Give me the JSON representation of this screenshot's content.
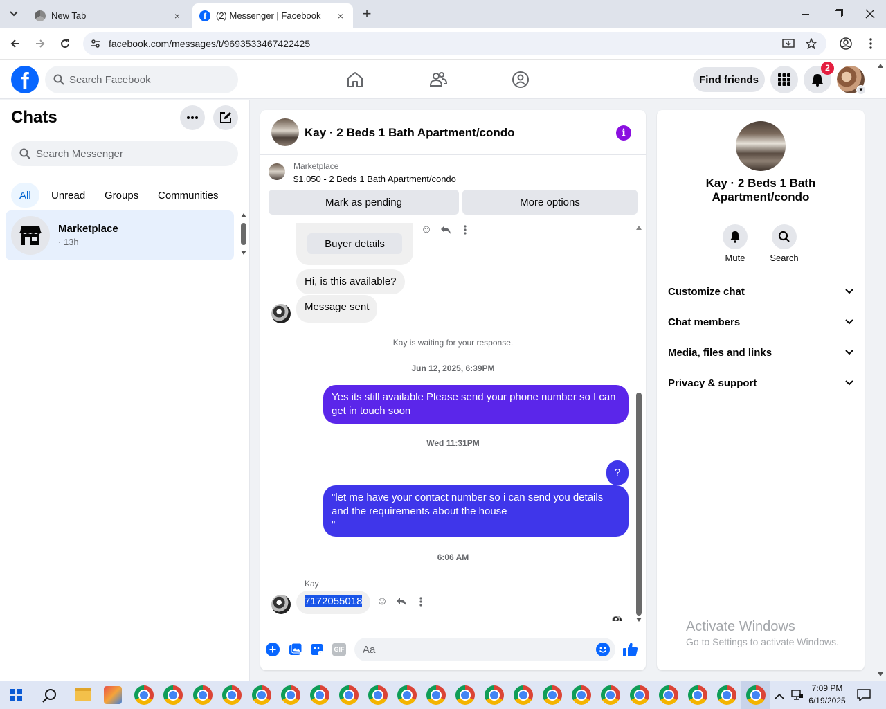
{
  "browser": {
    "tabs": [
      {
        "label": "New Tab",
        "active": false
      },
      {
        "label": "(2) Messenger | Facebook",
        "active": true
      }
    ],
    "new_tab_glyph": "+",
    "close_glyph": "×",
    "url": "facebook.com/messages/t/9693533467422425"
  },
  "fb_header": {
    "logo_letter": "f",
    "search_placeholder": "Search Facebook",
    "find_friends_label": "Find friends",
    "notification_count": "2",
    "nav_icons": [
      "home-icon",
      "friends-icon",
      "groups-icon"
    ]
  },
  "chats": {
    "title": "Chats",
    "search_placeholder": "Search Messenger",
    "filters": [
      "All",
      "Unread",
      "Groups",
      "Communities"
    ],
    "active_filter": "All",
    "items": [
      {
        "name": "Marketplace",
        "meta": "· 13h"
      }
    ]
  },
  "conversation": {
    "title": "Kay · 2 Beds 1 Bath Apartment/condo",
    "listing": {
      "source": "Marketplace",
      "summary": "$1,050 - 2 Beds 1 Bath Apartment/condo",
      "mark_pending_label": "Mark as pending",
      "more_options_label": "More options"
    },
    "messages": {
      "buyer_details_label": "Buyer details",
      "auto_question": "Hi, is this available?",
      "message_sent": "Message sent",
      "waiting_note": "Kay is waiting for your response.",
      "timestamp_1": "Jun 12, 2025, 6:39PM",
      "reply_1": "Yes its still available Please send your phone number so I can get in touch soon",
      "timestamp_2": "Wed 11:31PM",
      "reply_2": "?",
      "reply_3_line1": "\"let me have your contact number so i can send you details",
      "reply_3_line2": "and the requirements about the house",
      "reply_3_line3": "\"",
      "timestamp_3": "6:06 AM",
      "sender_name": "Kay",
      "phone_message": "7172055018"
    },
    "composer_placeholder": "Aa",
    "composer_icons": [
      "plus-icon",
      "photo-icon",
      "sticker-icon",
      "gif-icon",
      "emoji-icon",
      "thumbs-up-icon"
    ],
    "gif_label": "GIF",
    "accent_color": "#5b26ea"
  },
  "info_panel": {
    "title_line1": "Kay · 2 Beds 1 Bath",
    "title_line2": "Apartment/condo",
    "mute_label": "Mute",
    "search_label": "Search",
    "sections": [
      "Customize chat",
      "Chat members",
      "Media, files and links",
      "Privacy & support"
    ]
  },
  "watermark": {
    "line1": "Activate Windows",
    "line2": "Go to Settings to activate Windows."
  },
  "taskbar": {
    "time": "7:09 PM",
    "date": "6/19/2025"
  }
}
